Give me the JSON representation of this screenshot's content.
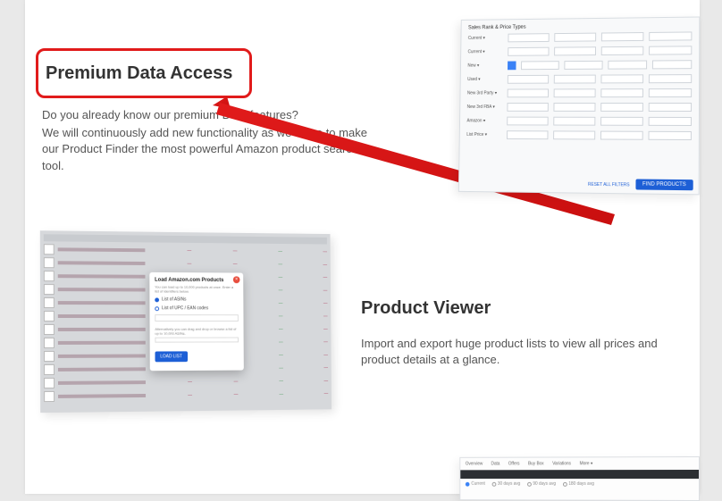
{
  "section1": {
    "title": "Premium Data Access",
    "line1": "Do you already know our premium Data features?",
    "line2": "We will continuously add new functionality as we strive to make our Product Finder the most powerful Amazon product search tool.",
    "mock": {
      "header": "Sales Rank & Price Types",
      "find_button": "FIND PRODUCTS",
      "reset_link": "RESET ALL FILTERS"
    }
  },
  "section2": {
    "title": "Product Viewer",
    "text": "Import and export huge product lists to view all prices and product details at a glance.",
    "modal": {
      "title": "Load Amazon.com Products",
      "option1": "List of ASINs",
      "option2": "List of UPC / EAN codes",
      "hint": "Alternatively you can drag and drop or browse a list of up to 10,000 ASINs.",
      "load_button": "LOAD LIST"
    }
  }
}
